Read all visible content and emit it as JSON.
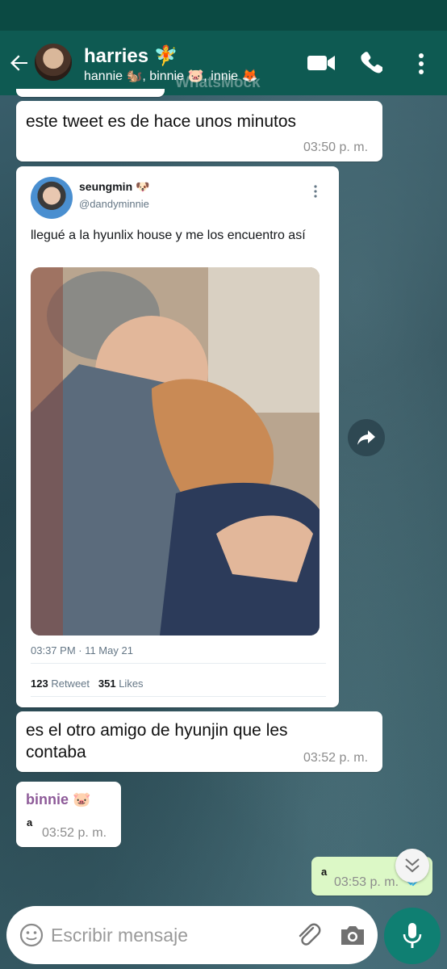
{
  "app": {
    "watermark": "WhatsMock"
  },
  "header": {
    "title": "harries 🧚",
    "subtitle": "hannie 🐿️, binnie 🐷, innie 🦊"
  },
  "messages": [
    {
      "text": "este tweet es de hace unos minutos",
      "time": "03:50 p. m."
    },
    {
      "text": "es el otro amigo de hyunjin que les contaba",
      "time": "03:52 p. m."
    },
    {
      "sender": "binnie 🐷",
      "text": "a",
      "time": "03:52 p. m."
    },
    {
      "text": "a",
      "time": "03:53 p. m.",
      "outgoing": true
    }
  ],
  "tweet": {
    "name": "seungmin 🐶",
    "handle": "@dandyminnie",
    "text": "llegué a la hyunlix house y me los encuentro así",
    "timestamp": "03:37 PM · 11 May 21",
    "retweets_count": "123",
    "retweets_label": "Retweet",
    "likes_count": "351",
    "likes_label": "Likes"
  },
  "input": {
    "placeholder": "Escribir mensaje"
  },
  "colors": {
    "header": "#0e5a52",
    "status": "#0b4a43",
    "outgoing": "#dcf8c6",
    "sender": "#8d5a98",
    "mic": "#0f7f72"
  }
}
